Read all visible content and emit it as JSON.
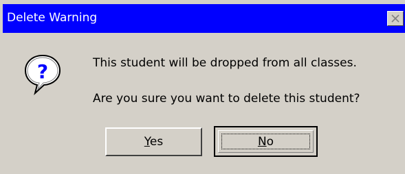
{
  "window": {
    "title": "Delete Warning",
    "close_icon": "close-icon"
  },
  "dialog": {
    "icon": "question-icon",
    "icon_glyph": "?",
    "message_line1": "This student will be dropped from all classes.",
    "message_line2": "Are you sure you want to delete this student?"
  },
  "buttons": {
    "yes_mnemonic": "Y",
    "yes_rest": "es",
    "no_mnemonic": "N",
    "no_rest": "o",
    "default": "No"
  },
  "colors": {
    "titlebar": "#0000ff",
    "face": "#d4d0c8",
    "icon_blue": "#0000ff"
  }
}
